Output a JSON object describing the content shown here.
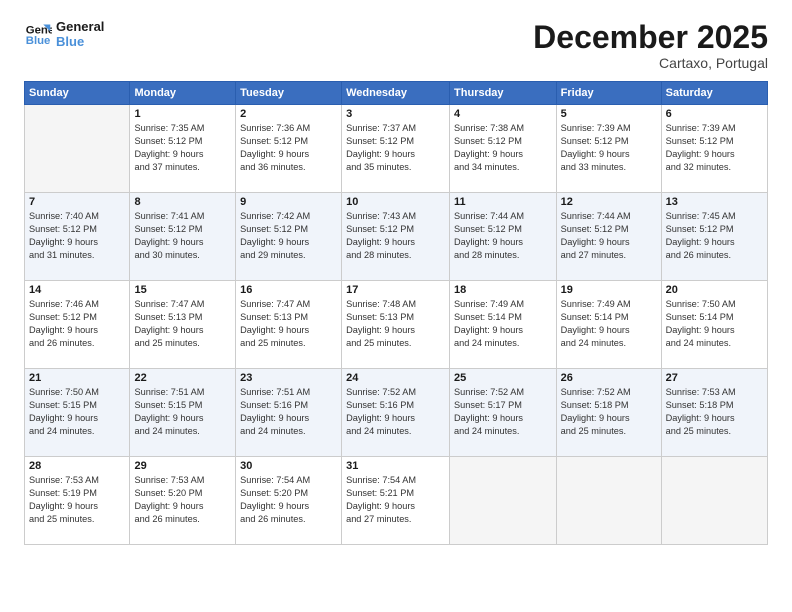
{
  "logo": {
    "line1": "General",
    "line2": "Blue"
  },
  "title": "December 2025",
  "subtitle": "Cartaxo, Portugal",
  "days_header": [
    "Sunday",
    "Monday",
    "Tuesday",
    "Wednesday",
    "Thursday",
    "Friday",
    "Saturday"
  ],
  "weeks": [
    [
      {
        "num": "",
        "info": ""
      },
      {
        "num": "1",
        "info": "Sunrise: 7:35 AM\nSunset: 5:12 PM\nDaylight: 9 hours\nand 37 minutes."
      },
      {
        "num": "2",
        "info": "Sunrise: 7:36 AM\nSunset: 5:12 PM\nDaylight: 9 hours\nand 36 minutes."
      },
      {
        "num": "3",
        "info": "Sunrise: 7:37 AM\nSunset: 5:12 PM\nDaylight: 9 hours\nand 35 minutes."
      },
      {
        "num": "4",
        "info": "Sunrise: 7:38 AM\nSunset: 5:12 PM\nDaylight: 9 hours\nand 34 minutes."
      },
      {
        "num": "5",
        "info": "Sunrise: 7:39 AM\nSunset: 5:12 PM\nDaylight: 9 hours\nand 33 minutes."
      },
      {
        "num": "6",
        "info": "Sunrise: 7:39 AM\nSunset: 5:12 PM\nDaylight: 9 hours\nand 32 minutes."
      }
    ],
    [
      {
        "num": "7",
        "info": "Sunrise: 7:40 AM\nSunset: 5:12 PM\nDaylight: 9 hours\nand 31 minutes."
      },
      {
        "num": "8",
        "info": "Sunrise: 7:41 AM\nSunset: 5:12 PM\nDaylight: 9 hours\nand 30 minutes."
      },
      {
        "num": "9",
        "info": "Sunrise: 7:42 AM\nSunset: 5:12 PM\nDaylight: 9 hours\nand 29 minutes."
      },
      {
        "num": "10",
        "info": "Sunrise: 7:43 AM\nSunset: 5:12 PM\nDaylight: 9 hours\nand 28 minutes."
      },
      {
        "num": "11",
        "info": "Sunrise: 7:44 AM\nSunset: 5:12 PM\nDaylight: 9 hours\nand 28 minutes."
      },
      {
        "num": "12",
        "info": "Sunrise: 7:44 AM\nSunset: 5:12 PM\nDaylight: 9 hours\nand 27 minutes."
      },
      {
        "num": "13",
        "info": "Sunrise: 7:45 AM\nSunset: 5:12 PM\nDaylight: 9 hours\nand 26 minutes."
      }
    ],
    [
      {
        "num": "14",
        "info": "Sunrise: 7:46 AM\nSunset: 5:12 PM\nDaylight: 9 hours\nand 26 minutes."
      },
      {
        "num": "15",
        "info": "Sunrise: 7:47 AM\nSunset: 5:13 PM\nDaylight: 9 hours\nand 25 minutes."
      },
      {
        "num": "16",
        "info": "Sunrise: 7:47 AM\nSunset: 5:13 PM\nDaylight: 9 hours\nand 25 minutes."
      },
      {
        "num": "17",
        "info": "Sunrise: 7:48 AM\nSunset: 5:13 PM\nDaylight: 9 hours\nand 25 minutes."
      },
      {
        "num": "18",
        "info": "Sunrise: 7:49 AM\nSunset: 5:14 PM\nDaylight: 9 hours\nand 24 minutes."
      },
      {
        "num": "19",
        "info": "Sunrise: 7:49 AM\nSunset: 5:14 PM\nDaylight: 9 hours\nand 24 minutes."
      },
      {
        "num": "20",
        "info": "Sunrise: 7:50 AM\nSunset: 5:14 PM\nDaylight: 9 hours\nand 24 minutes."
      }
    ],
    [
      {
        "num": "21",
        "info": "Sunrise: 7:50 AM\nSunset: 5:15 PM\nDaylight: 9 hours\nand 24 minutes."
      },
      {
        "num": "22",
        "info": "Sunrise: 7:51 AM\nSunset: 5:15 PM\nDaylight: 9 hours\nand 24 minutes."
      },
      {
        "num": "23",
        "info": "Sunrise: 7:51 AM\nSunset: 5:16 PM\nDaylight: 9 hours\nand 24 minutes."
      },
      {
        "num": "24",
        "info": "Sunrise: 7:52 AM\nSunset: 5:16 PM\nDaylight: 9 hours\nand 24 minutes."
      },
      {
        "num": "25",
        "info": "Sunrise: 7:52 AM\nSunset: 5:17 PM\nDaylight: 9 hours\nand 24 minutes."
      },
      {
        "num": "26",
        "info": "Sunrise: 7:52 AM\nSunset: 5:18 PM\nDaylight: 9 hours\nand 25 minutes."
      },
      {
        "num": "27",
        "info": "Sunrise: 7:53 AM\nSunset: 5:18 PM\nDaylight: 9 hours\nand 25 minutes."
      }
    ],
    [
      {
        "num": "28",
        "info": "Sunrise: 7:53 AM\nSunset: 5:19 PM\nDaylight: 9 hours\nand 25 minutes."
      },
      {
        "num": "29",
        "info": "Sunrise: 7:53 AM\nSunset: 5:20 PM\nDaylight: 9 hours\nand 26 minutes."
      },
      {
        "num": "30",
        "info": "Sunrise: 7:54 AM\nSunset: 5:20 PM\nDaylight: 9 hours\nand 26 minutes."
      },
      {
        "num": "31",
        "info": "Sunrise: 7:54 AM\nSunset: 5:21 PM\nDaylight: 9 hours\nand 27 minutes."
      },
      {
        "num": "",
        "info": ""
      },
      {
        "num": "",
        "info": ""
      },
      {
        "num": "",
        "info": ""
      }
    ]
  ]
}
